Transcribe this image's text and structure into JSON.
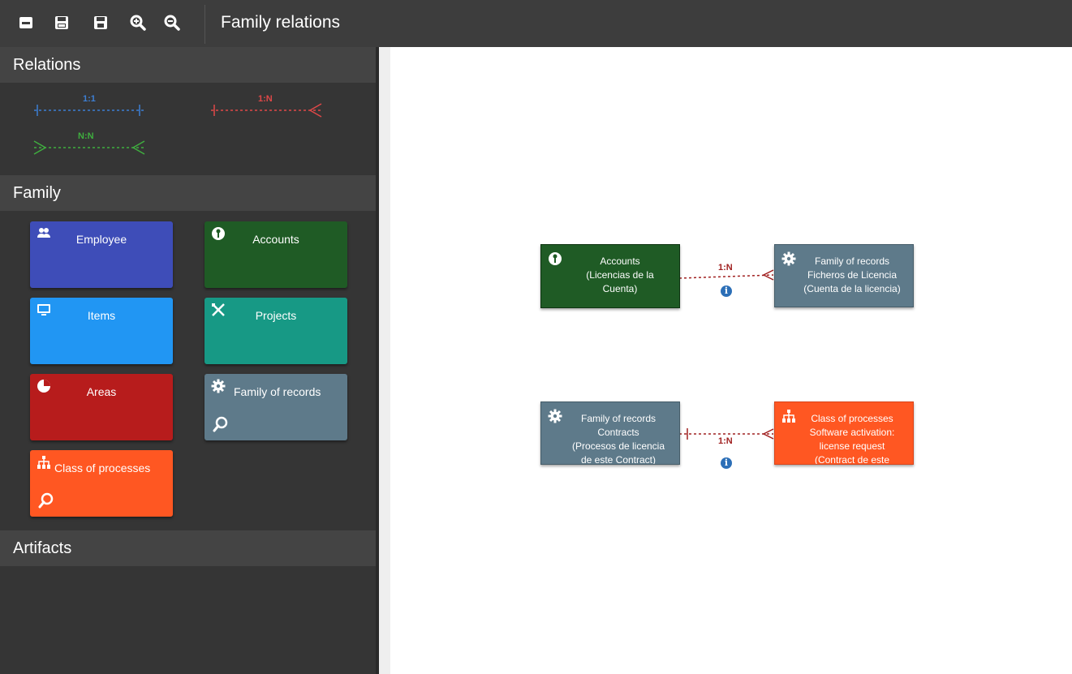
{
  "app": {
    "title": "Family relations"
  },
  "toolbar": {
    "buttons": [
      "minimize-icon",
      "save-icon",
      "save-as-icon",
      "zoom-in-icon",
      "zoom-out-icon"
    ]
  },
  "sidebar": {
    "relations": {
      "header": "Relations",
      "items": [
        {
          "label": "1:1",
          "color": "#3d7fd4"
        },
        {
          "label": "1:N",
          "color": "#e04848"
        },
        {
          "label": "N:N",
          "color": "#3fae3f"
        }
      ]
    },
    "family": {
      "header": "Family",
      "tiles": [
        {
          "label": "Employee",
          "color": "#3e4db8",
          "icon": "users-icon"
        },
        {
          "label": "Accounts",
          "color": "#1f5b25",
          "icon": "key-icon"
        },
        {
          "label": "Items",
          "color": "#2196f3",
          "icon": "monitor-icon"
        },
        {
          "label": "Projects",
          "color": "#179985",
          "icon": "tools-icon"
        },
        {
          "label": "Areas",
          "color": "#b71c1c",
          "icon": "pie-chart-icon"
        },
        {
          "label": "Family of records",
          "color": "#5e7a8a",
          "icon": "gear-icon"
        },
        {
          "label": "Class of processes",
          "color": "#ff5722",
          "icon": "hierarchy-icon"
        }
      ]
    },
    "artifacts": {
      "header": "Artifacts"
    }
  },
  "canvas": {
    "nodes": [
      {
        "lines": [
          "Accounts",
          "(Licencias de la",
          "Cuenta)"
        ],
        "color": "#1f5b25",
        "icon": "key-icon"
      },
      {
        "lines": [
          "Family of records",
          "Ficheros de Licencia",
          "(Cuenta de la licencia)"
        ],
        "color": "#5e7a8a",
        "icon": "gear-icon"
      },
      {
        "lines": [
          "Family of records",
          "Contracts",
          "(Procesos de licencia",
          "de este Contract)"
        ],
        "color": "#5e7a8a",
        "icon": "gear-icon"
      },
      {
        "lines": [
          "Class of processes",
          "Software activation:",
          "license request",
          "(Contract de este"
        ],
        "color": "#ff5722",
        "icon": "hierarchy-icon"
      }
    ],
    "connections": [
      {
        "label": "1:N",
        "info": "i"
      },
      {
        "label": "1:N",
        "info": "i"
      }
    ]
  }
}
